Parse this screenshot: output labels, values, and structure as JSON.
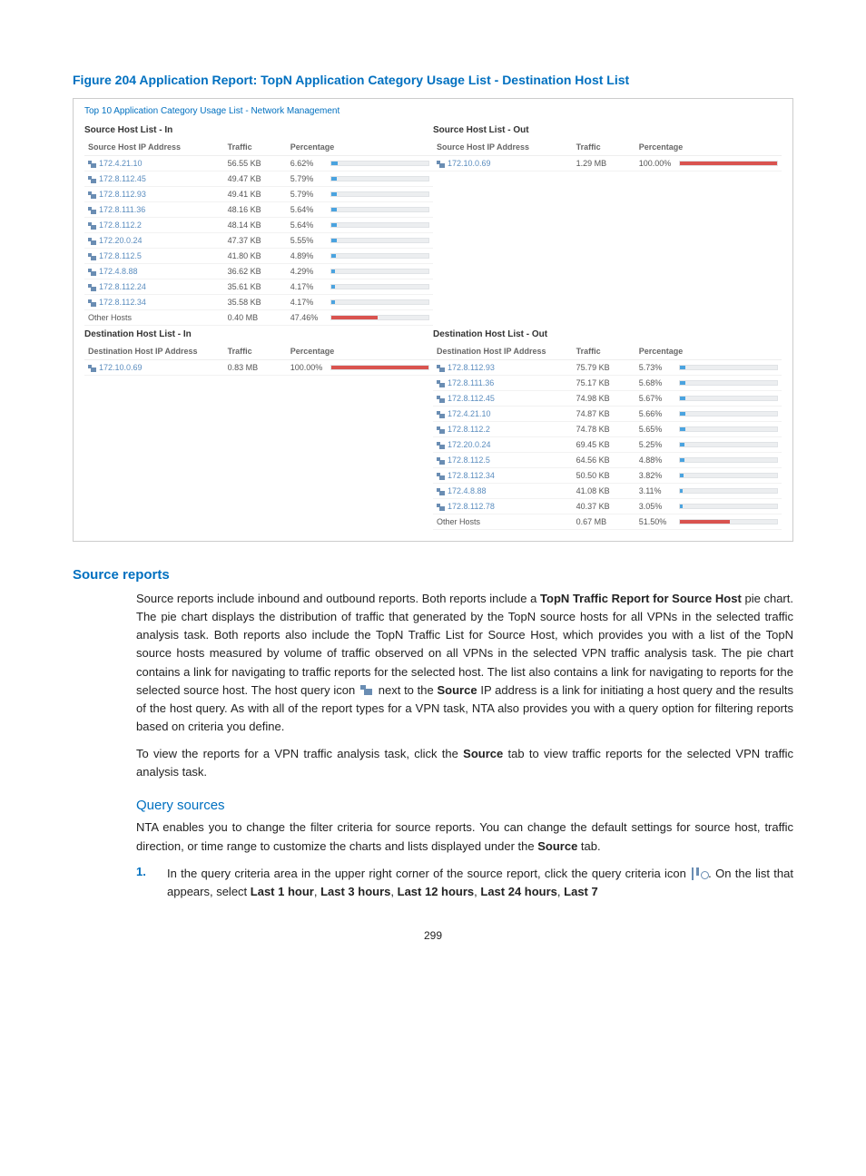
{
  "figure_title": "Figure 204 Application Report: TopN Application Category Usage List - Destination Host List",
  "report": {
    "title": "Top 10 Application Category Usage List - Network Management",
    "panels": [
      {
        "title": "Source Host List - In",
        "headers": [
          "Source Host IP Address",
          "Traffic",
          "Percentage"
        ],
        "rows": [
          {
            "ip": "172.4.21.10",
            "traffic": "56.55 KB",
            "pct": "6.62%",
            "pv": 6.62,
            "other": false
          },
          {
            "ip": "172.8.112.45",
            "traffic": "49.47 KB",
            "pct": "5.79%",
            "pv": 5.79,
            "other": false
          },
          {
            "ip": "172.8.112.93",
            "traffic": "49.41 KB",
            "pct": "5.79%",
            "pv": 5.79,
            "other": false
          },
          {
            "ip": "172.8.111.36",
            "traffic": "48.16 KB",
            "pct": "5.64%",
            "pv": 5.64,
            "other": false
          },
          {
            "ip": "172.8.112.2",
            "traffic": "48.14 KB",
            "pct": "5.64%",
            "pv": 5.64,
            "other": false
          },
          {
            "ip": "172.20.0.24",
            "traffic": "47.37 KB",
            "pct": "5.55%",
            "pv": 5.55,
            "other": false
          },
          {
            "ip": "172.8.112.5",
            "traffic": "41.80 KB",
            "pct": "4.89%",
            "pv": 4.89,
            "other": false
          },
          {
            "ip": "172.4.8.88",
            "traffic": "36.62 KB",
            "pct": "4.29%",
            "pv": 4.29,
            "other": false
          },
          {
            "ip": "172.8.112.24",
            "traffic": "35.61 KB",
            "pct": "4.17%",
            "pv": 4.17,
            "other": false
          },
          {
            "ip": "172.8.112.34",
            "traffic": "35.58 KB",
            "pct": "4.17%",
            "pv": 4.17,
            "other": false
          },
          {
            "ip": "Other Hosts",
            "traffic": "0.40 MB",
            "pct": "47.46%",
            "pv": 47.46,
            "other": true
          }
        ]
      },
      {
        "title": "Source Host List - Out",
        "headers": [
          "Source Host IP Address",
          "Traffic",
          "Percentage"
        ],
        "rows": [
          {
            "ip": "172.10.0.69",
            "traffic": "1.29 MB",
            "pct": "100.00%",
            "pv": 100,
            "other": false
          }
        ]
      },
      {
        "title": "Destination Host List - In",
        "headers": [
          "Destination Host IP Address",
          "Traffic",
          "Percentage"
        ],
        "rows": [
          {
            "ip": "172.10.0.69",
            "traffic": "0.83 MB",
            "pct": "100.00%",
            "pv": 100,
            "other": false
          }
        ]
      },
      {
        "title": "Destination Host List - Out",
        "headers": [
          "Destination Host IP Address",
          "Traffic",
          "Percentage"
        ],
        "rows": [
          {
            "ip": "172.8.112.93",
            "traffic": "75.79 KB",
            "pct": "5.73%",
            "pv": 5.73,
            "other": false
          },
          {
            "ip": "172.8.111.36",
            "traffic": "75.17 KB",
            "pct": "5.68%",
            "pv": 5.68,
            "other": false
          },
          {
            "ip": "172.8.112.45",
            "traffic": "74.98 KB",
            "pct": "5.67%",
            "pv": 5.67,
            "other": false
          },
          {
            "ip": "172.4.21.10",
            "traffic": "74.87 KB",
            "pct": "5.66%",
            "pv": 5.66,
            "other": false
          },
          {
            "ip": "172.8.112.2",
            "traffic": "74.78 KB",
            "pct": "5.65%",
            "pv": 5.65,
            "other": false
          },
          {
            "ip": "172.20.0.24",
            "traffic": "69.45 KB",
            "pct": "5.25%",
            "pv": 5.25,
            "other": false
          },
          {
            "ip": "172.8.112.5",
            "traffic": "64.56 KB",
            "pct": "4.88%",
            "pv": 4.88,
            "other": false
          },
          {
            "ip": "172.8.112.34",
            "traffic": "50.50 KB",
            "pct": "3.82%",
            "pv": 3.82,
            "other": false
          },
          {
            "ip": "172.4.8.88",
            "traffic": "41.08 KB",
            "pct": "3.11%",
            "pv": 3.11,
            "other": false
          },
          {
            "ip": "172.8.112.78",
            "traffic": "40.37 KB",
            "pct": "3.05%",
            "pv": 3.05,
            "other": false
          },
          {
            "ip": "Other Hosts",
            "traffic": "0.67 MB",
            "pct": "51.50%",
            "pv": 51.5,
            "other": true
          }
        ]
      }
    ]
  },
  "sections": {
    "source_reports_h": "Source reports",
    "p1_a": "Source reports include inbound and outbound reports. Both reports include a ",
    "p1_b": "TopN Traffic Report for Source Host",
    "p1_c": " pie chart. The pie chart displays the distribution of traffic that generated by the TopN source hosts for all VPNs in the selected traffic analysis task. Both reports also include the TopN Traffic List for Source Host, which provides you with a list of the TopN source hosts measured by volume of traffic observed on all VPNs in the selected VPN traffic analysis task. The pie chart contains a link for navigating to traffic reports for the selected host. The list also contains a link for navigating to reports for the selected source host. The host query icon ",
    "p1_d": " next to the ",
    "p1_src": "Source",
    "p1_e": " IP address is a link for initiating a host query and the results of the host query. As with all of the report types for a VPN task, NTA also provides you with a query option for filtering reports based on criteria you define.",
    "p2_a": "To view the reports for a VPN traffic analysis task, click the ",
    "p2_src": "Source",
    "p2_b": " tab to view traffic reports for the selected VPN traffic analysis task.",
    "query_h": "Query sources",
    "q1": "NTA enables you to change the filter criteria for source reports. You can change the default settings for source host, traffic direction, or time range to customize the charts and lists displayed under the ",
    "q1_src": "Source",
    "q1_end": " tab.",
    "ol_num": "1.",
    "ol_a": "In the query criteria area in the upper right corner of the source report, click the query criteria icon ",
    "ol_b": ". On the list that appears, select ",
    "opt1": "Last 1 hour",
    "opt2": "Last 3 hours",
    "opt3": "Last 12 hours",
    "opt4": "Last 24 hours",
    "opt5": "Last 7",
    "sep": ", "
  },
  "page_number": "299"
}
